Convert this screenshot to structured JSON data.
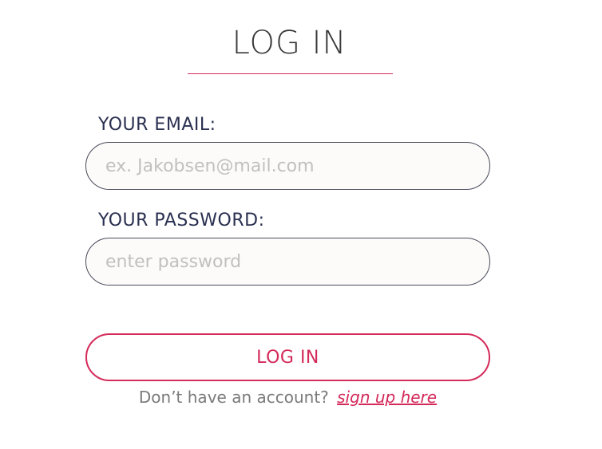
{
  "header": {
    "title": "LOG IN"
  },
  "form": {
    "email_label": "YOUR EMAIL:",
    "email_placeholder": "ex. Jakobsen@mail.com",
    "email_value": "",
    "password_label": "YOUR PASSWORD:",
    "password_placeholder": "enter password",
    "password_value": "",
    "submit_label": "LOG IN"
  },
  "signup": {
    "prompt": "Don’t have an account?",
    "link_label": "sign up here"
  },
  "colors": {
    "accent": "#d42a5a",
    "label": "#2a3050",
    "title": "#3a3a3a"
  }
}
